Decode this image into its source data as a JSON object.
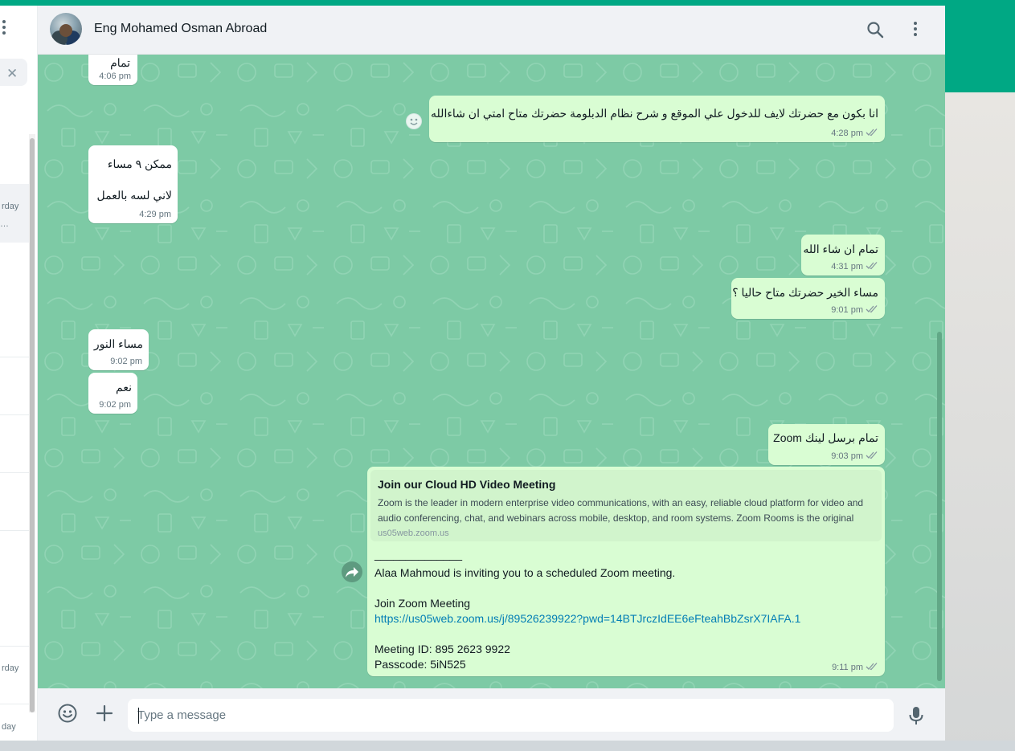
{
  "header": {
    "contact_name": "Eng Mohamed Osman Abroad"
  },
  "sidebar": {
    "fragments": [
      "rday",
      "…",
      "rday",
      "day"
    ]
  },
  "messages": [
    {
      "dir": "in",
      "text": "تمام",
      "time": "4:06 pm"
    },
    {
      "dir": "out",
      "text": "انا بكون مع حضرتك لايف للدخول علي الموقع و شرح نظام الدبلومة حضرتك متاح امتي ان شاءالله",
      "time": "4:28 pm"
    },
    {
      "dir": "in",
      "line1": "ممكن ٩ مساء",
      "line2": "لاني لسه بالعمل",
      "time": "4:29 pm"
    },
    {
      "dir": "out",
      "text": "تمام ان شاء الله",
      "time": "4:31 pm"
    },
    {
      "dir": "out",
      "text": "مساء الخير حضرتك متاح حاليا ؟",
      "time": "9:01 pm"
    },
    {
      "dir": "in",
      "text": "مساء النور",
      "time": "9:02 pm"
    },
    {
      "dir": "in",
      "text": "نعم",
      "time": "9:02 pm"
    },
    {
      "dir": "out",
      "text": "تمام برسل لينك Zoom",
      "time": "9:03 pm"
    },
    {
      "dir": "out",
      "link_preview": {
        "title": "Join our Cloud HD Video Meeting",
        "description": "Zoom is the leader in modern enterprise video communications, with an easy, reliable cloud platform for video and audio conferencing, chat, and webinars across mobile, desktop, and room systems. Zoom Rooms is the original",
        "domain": "us05web.zoom.us"
      },
      "body": {
        "separator": "______________",
        "invite": "Alaa Mahmoud is inviting you to a scheduled Zoom meeting.",
        "join_label": "Join Zoom Meeting",
        "url": "https://us05web.zoom.us/j/89526239922?pwd=14BTJrczIdEE6eFteahBbZsrX7IAFA.1",
        "meeting_id": "Meeting ID: 895 2623 9922",
        "passcode": "Passcode: 5iN525"
      },
      "time": "9:11 pm"
    }
  ],
  "composer": {
    "placeholder": "Type a message"
  },
  "icons": {
    "search": "search-icon",
    "menu": "menu-icon",
    "emoji": "emoji-icon",
    "attach": "plus-icon",
    "mic": "mic-icon",
    "forward": "forward-icon",
    "read": "double-check-icon"
  },
  "colors": {
    "accent": "#00a884",
    "chat_bg": "#7dcaa5",
    "outgoing_bubble": "#d9fdd3",
    "incoming_bubble": "#ffffff",
    "link": "#027eb5",
    "tick": "#8696a0"
  }
}
